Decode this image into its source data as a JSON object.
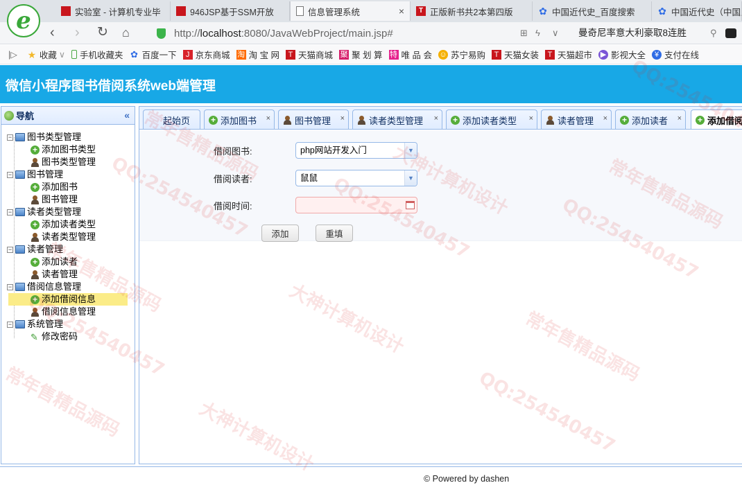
{
  "browser": {
    "logo_letter": "e",
    "tabs": [
      {
        "label": "实验室 - 计算机专业毕",
        "icon": "red-square-icon",
        "active": false
      },
      {
        "label": "946JSP基于SSM开放",
        "icon": "red-square-icon",
        "active": false
      },
      {
        "label": "信息管理系统",
        "icon": "page-icon",
        "active": true
      },
      {
        "label": "正版新书共2本第四版",
        "icon": "tmall-icon",
        "active": false
      },
      {
        "label": "中国近代史_百度搜索",
        "icon": "baidu-paw-icon",
        "active": false
      },
      {
        "label": "中国近代史（中国历",
        "icon": "baidu-paw-icon",
        "active": false
      }
    ],
    "tab_close_glyph": "×",
    "url_prefix": "http://",
    "url_host": "localhost",
    "url_rest": ":8080/JavaWebProject/main.jsp#",
    "search_text": "曼奇尼率意大利豪取8连胜",
    "bookmarks": [
      {
        "label": "收藏",
        "icon": "star-icon",
        "color": "#f3b82a"
      },
      {
        "label": "手机收藏夹",
        "icon": "phone-icon",
        "color": "#4aa844"
      },
      {
        "label": "百度一下",
        "icon": "baidu-paw-icon",
        "color": "#2f6ce5"
      },
      {
        "label": "京东商城",
        "icon": "jd-icon",
        "color": "#d8232a"
      },
      {
        "label": "淘 宝 网",
        "icon": "taobao-icon",
        "color": "#ff6a00"
      },
      {
        "label": "天猫商城",
        "icon": "tmall-icon",
        "color": "#c8161d"
      },
      {
        "label": "聚 划 算",
        "icon": "juhuasuan-icon",
        "color": "#d61f6a"
      },
      {
        "label": "唯 品 会",
        "icon": "vip-icon",
        "color": "#e5208b"
      },
      {
        "label": "苏宁易购",
        "icon": "suning-icon",
        "color": "#f5b000"
      },
      {
        "label": "天猫女装",
        "icon": "tmall-icon",
        "color": "#c8161d"
      },
      {
        "label": "天猫超市",
        "icon": "tmall-icon",
        "color": "#c8161d"
      },
      {
        "label": "影视大全",
        "icon": "video-icon",
        "color": "#7b55d6"
      },
      {
        "label": "支付在线",
        "icon": "pay-icon",
        "color": "#2f6ce5"
      }
    ]
  },
  "app": {
    "title": "微信小程序图书借阅系统web端管理",
    "header_color": "#18a8e6",
    "nav": {
      "title": "导航",
      "collapse_glyph": "«",
      "groups": [
        {
          "label": "图书类型管理",
          "children": [
            {
              "label": "添加图书类型",
              "icon": "add-icon"
            },
            {
              "label": "图书类型管理",
              "icon": "user-icon"
            }
          ]
        },
        {
          "label": "图书管理",
          "children": [
            {
              "label": "添加图书",
              "icon": "add-icon"
            },
            {
              "label": "图书管理",
              "icon": "user-icon"
            }
          ]
        },
        {
          "label": "读者类型管理",
          "children": [
            {
              "label": "添加读者类型",
              "icon": "add-icon"
            },
            {
              "label": "读者类型管理",
              "icon": "user-icon"
            }
          ]
        },
        {
          "label": "读者管理",
          "children": [
            {
              "label": "添加读者",
              "icon": "add-icon"
            },
            {
              "label": "读者管理",
              "icon": "user-icon"
            }
          ]
        },
        {
          "label": "借阅信息管理",
          "children": [
            {
              "label": "添加借阅信息",
              "icon": "add-icon",
              "selected": true
            },
            {
              "label": "借阅信息管理",
              "icon": "user-icon"
            }
          ]
        },
        {
          "label": "系统管理",
          "children": [
            {
              "label": "修改密码",
              "icon": "pencil-icon"
            }
          ]
        }
      ]
    },
    "center_tabs": [
      {
        "label": "起始页",
        "icon": "",
        "closable": false
      },
      {
        "label": "添加图书",
        "icon": "add-icon",
        "closable": true
      },
      {
        "label": "图书管理",
        "icon": "user-icon",
        "closable": true
      },
      {
        "label": "读者类型管理",
        "icon": "user-icon",
        "closable": true
      },
      {
        "label": "添加读者类型",
        "icon": "add-icon",
        "closable": true
      },
      {
        "label": "读者管理",
        "icon": "user-icon",
        "closable": true
      },
      {
        "label": "添加读者",
        "icon": "add-icon",
        "closable": true
      },
      {
        "label": "添加借阅",
        "icon": "add-icon",
        "closable": false,
        "active": true
      }
    ],
    "form": {
      "book_label": "借阅图书:",
      "book_value": "php网站开发入门",
      "reader_label": "借阅读者:",
      "reader_value": "鼠鼠",
      "time_label": "借阅时间:",
      "time_value": "",
      "submit_label": "添加",
      "reset_label": "重填"
    },
    "footer": "© Powered by dashen"
  },
  "watermark": {
    "texts": [
      "QQ:254540457",
      "大神计算机设计",
      "常年售精品源码"
    ]
  }
}
